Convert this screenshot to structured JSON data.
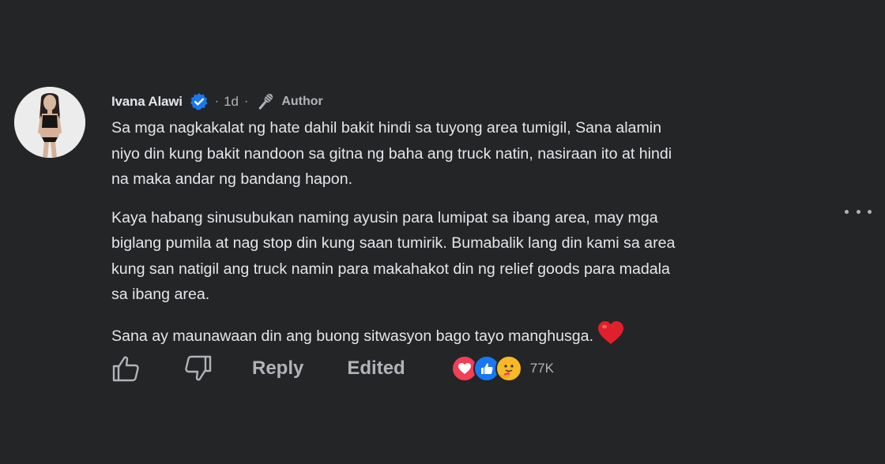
{
  "comment": {
    "author": "Ivana Alawi",
    "separator": "·",
    "time": "1d",
    "badge": "Author",
    "paragraphs": [
      "Sa mga nagkakalat ng hate dahil bakit hindi sa tuyong area tumigil, Sana alamin\nniyo din kung bakit nandoon sa gitna ng baha ang truck natin, nasiraan ito at hindi\nna maka andar ng bandang hapon.",
      "Kaya habang sinusubukan naming ayusin para lumipat sa ibang area, may mga\nbiglang pumila at nag stop din kung saan tumirik. Bumabalik lang din kami sa area\nkung san natigil ang truck namin para makahakot din ng relief goods para madala\nsa ibang area.",
      "Sana ay maunawaan din ang buong sitwasyon bago tayo manghusga."
    ]
  },
  "actions": {
    "reply": "Reply",
    "edited": "Edited",
    "reaction_count": "77K"
  },
  "icons": {
    "verified": "verified-check-icon",
    "author": "microphone-icon",
    "like": "thumbs-up-icon",
    "dislike": "thumbs-down-icon",
    "more": "more-options-icon",
    "reactions": [
      "love-reaction-icon",
      "like-reaction-icon",
      "care-reaction-icon"
    ],
    "inline_emoji": "red-heart-emoji"
  },
  "colors": {
    "background": "#242526",
    "primary_text": "#e4e6eb",
    "secondary_text": "#b0b3b8",
    "verified_blue": "#1877f2",
    "love_red": "#f33e58",
    "heart_red": "#e0202c"
  }
}
